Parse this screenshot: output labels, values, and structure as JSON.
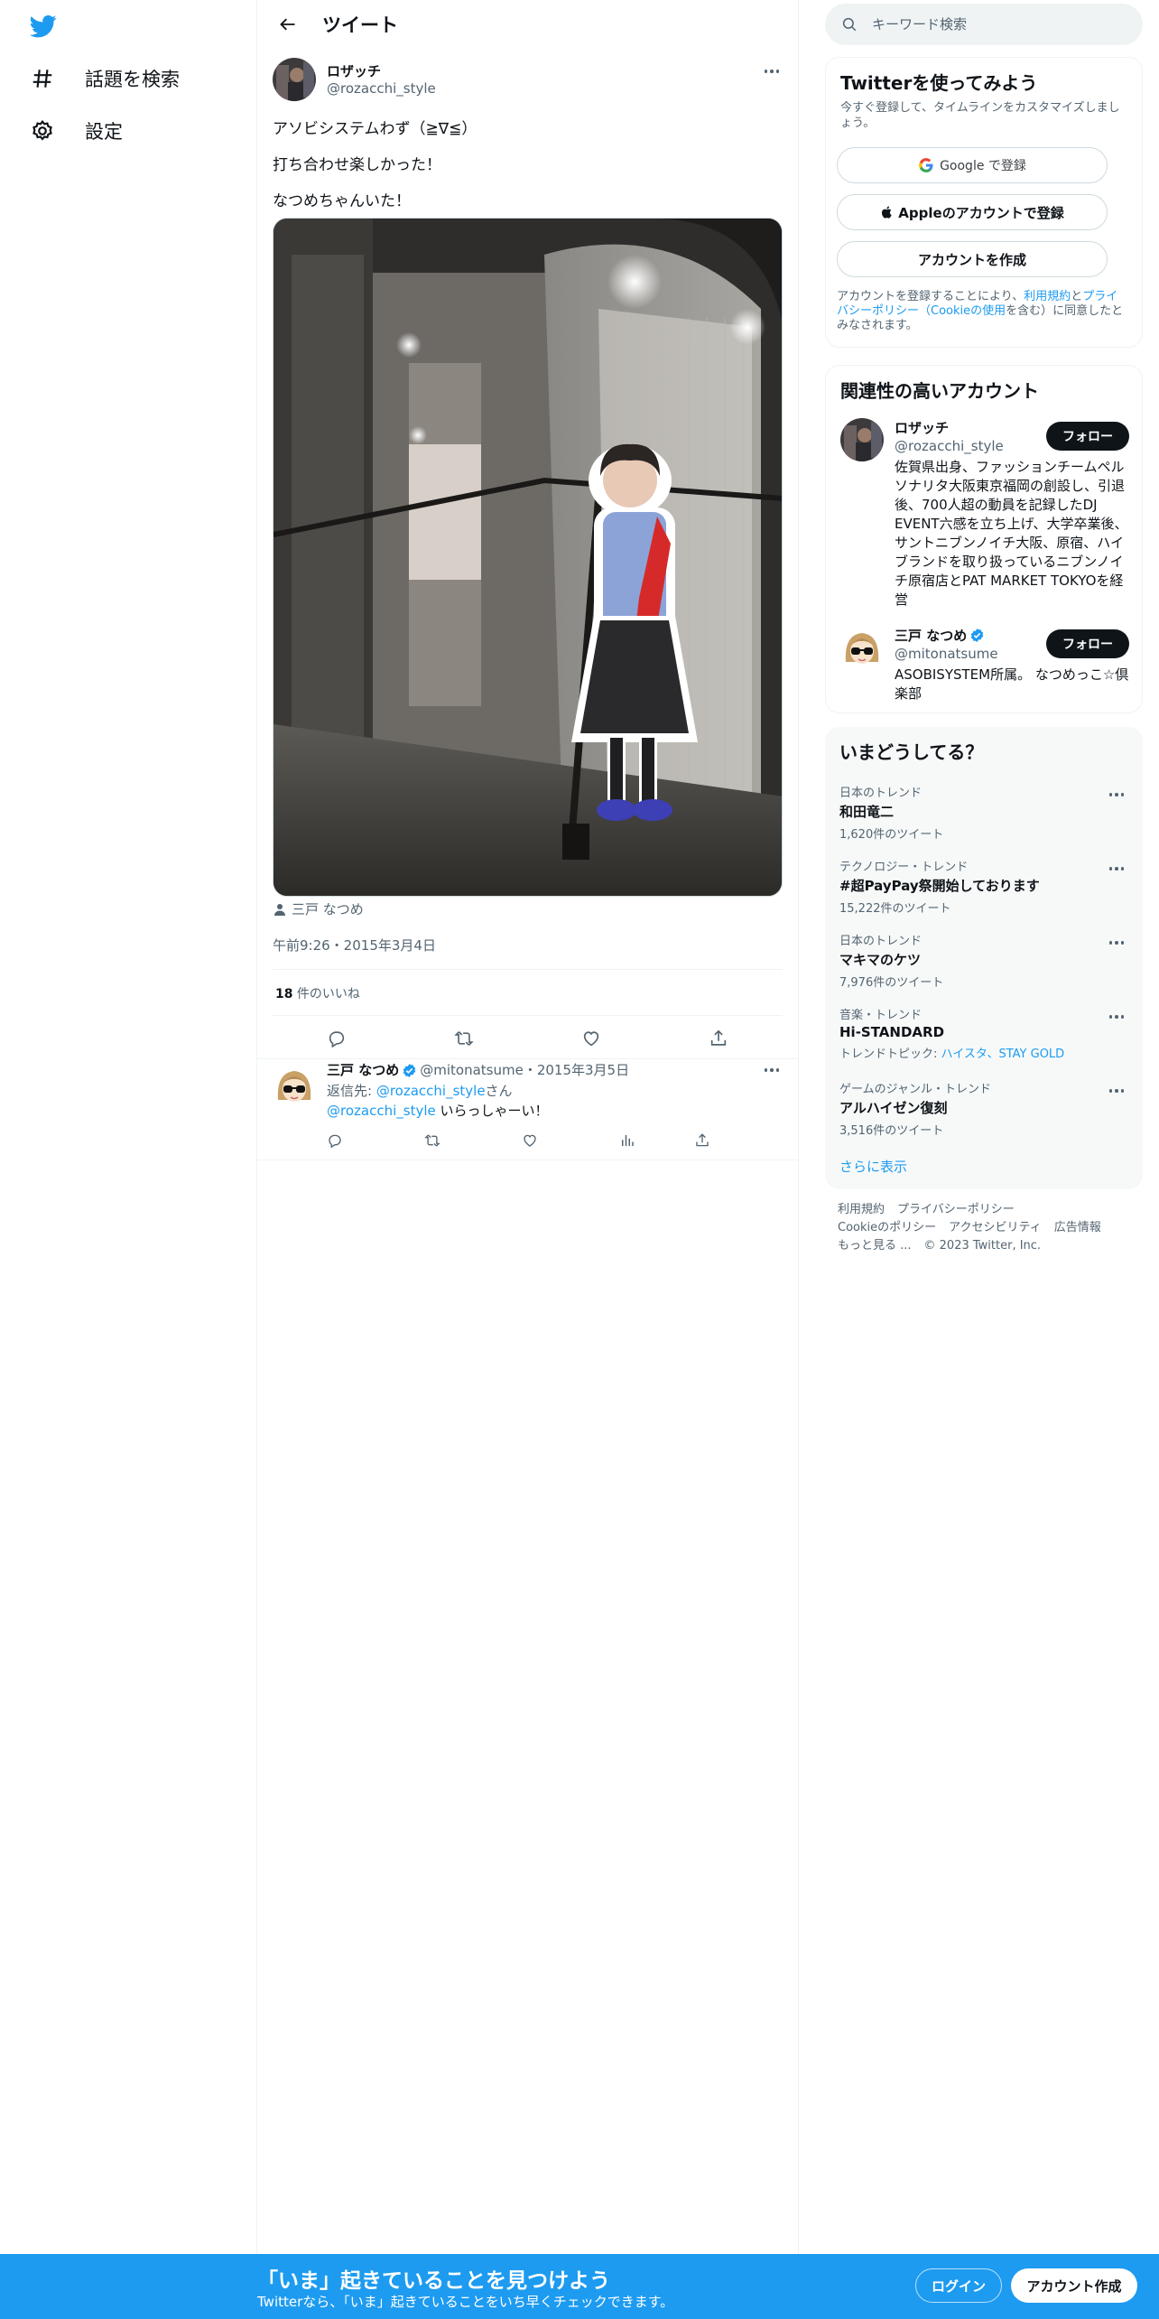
{
  "nav": {
    "explore_label": "話題を検索",
    "settings_label": "設定"
  },
  "header": {
    "title": "ツイート"
  },
  "tweet": {
    "author_name": "ロザッチ",
    "author_handle": "@rozacchi_style",
    "lines": [
      "アソビシステムわず（≧∇≦）",
      "打ち合わせ楽しかった！",
      "なつめちゃんいた！"
    ],
    "tagged_user": "三戸 なつめ",
    "timestamp": "午前9:26・2015年3月4日",
    "likes_count": "18",
    "likes_label": " 件のいいね"
  },
  "reply": {
    "name": "三戸 なつめ",
    "handle": "@mitonatsume",
    "date": "・2015年3月5日",
    "replying_prefix": "返信先: ",
    "replying_link": "@rozacchi_style",
    "replying_suffix": "さん",
    "text_link": "@rozacchi_style",
    "text": " いらっしゃーい！"
  },
  "search": {
    "placeholder": "キーワード検索"
  },
  "signup_card": {
    "title": "Twitterを使ってみよう",
    "subtitle": "今すぐ登録して、タイムラインをカスタマイズしましょう。",
    "google_label": "Google で登録",
    "apple_label": "Appleのアカウントで登録",
    "create_label": "アカウントを作成",
    "legal_prefix": "アカウントを登録することにより、",
    "legal_terms": "利用規約",
    "legal_and": "と",
    "legal_privacy": "プライバシーポリシー（Cookieの使用",
    "legal_suffix": "を含む）に同意したとみなされます。"
  },
  "relevant": {
    "title": "関連性の高いアカウント",
    "follow_label": "フォロー",
    "accounts": [
      {
        "name": "ロザッチ",
        "handle": "@rozacchi_style",
        "bio": "佐賀県出身、ファッションチームペルソナリタ大阪東京福岡の創設し、引退後、700人超の動員を記録したDJ EVENT六感を立ち上げ、大学卒業後、サントニブンノイチ大阪、原宿、ハイブランドを取り扱っているニブンノイチ原宿店とPAT MARKET TOKYOを経営"
      },
      {
        "name": "三戸 なつめ",
        "handle": "@mitonatsume",
        "bio": "ASOBISYSTEM所属。 なつめっこ☆倶楽部"
      }
    ]
  },
  "trends": {
    "title": "いまどうしてる？",
    "items": [
      {
        "meta": "日本のトレンド",
        "name": "和田竜二",
        "count": "1,620件のツイート"
      },
      {
        "meta": "テクノロジー・トレンド",
        "name": "#超PayPay祭開始しております",
        "count": "15,222件のツイート"
      },
      {
        "meta": "日本のトレンド",
        "name": "マキマのケツ",
        "count": "7,976件のツイート"
      },
      {
        "meta": "音楽・トレンド",
        "name": "Hi-STANDARD",
        "count_prefix": "トレンドトピック: ",
        "count_links": "ハイスタ、STAY GOLD"
      },
      {
        "meta": "ゲームのジャンル・トレンド",
        "name": "アルハイゼン復刻",
        "count": "3,516件のツイート"
      }
    ],
    "show_more": "さらに表示"
  },
  "footer": {
    "terms": "利用規約",
    "privacy": "プライバシーポリシー",
    "cookie": "Cookieのポリシー",
    "accessibility": "アクセシビリティ",
    "ads": "広告情報",
    "more": "もっと見る ...",
    "copyright": "© 2023 Twitter, Inc."
  },
  "bottom_bar": {
    "headline": "「いま」起きていることを見つけよう",
    "subline": "Twitterなら、「いま」起きていることをいち早くチェックできます。",
    "login_label": "ログイン",
    "signup_label": "アカウント作成"
  },
  "colors": {
    "brand": "#1d9bf0",
    "text": "#0f1419",
    "muted": "#536471"
  }
}
